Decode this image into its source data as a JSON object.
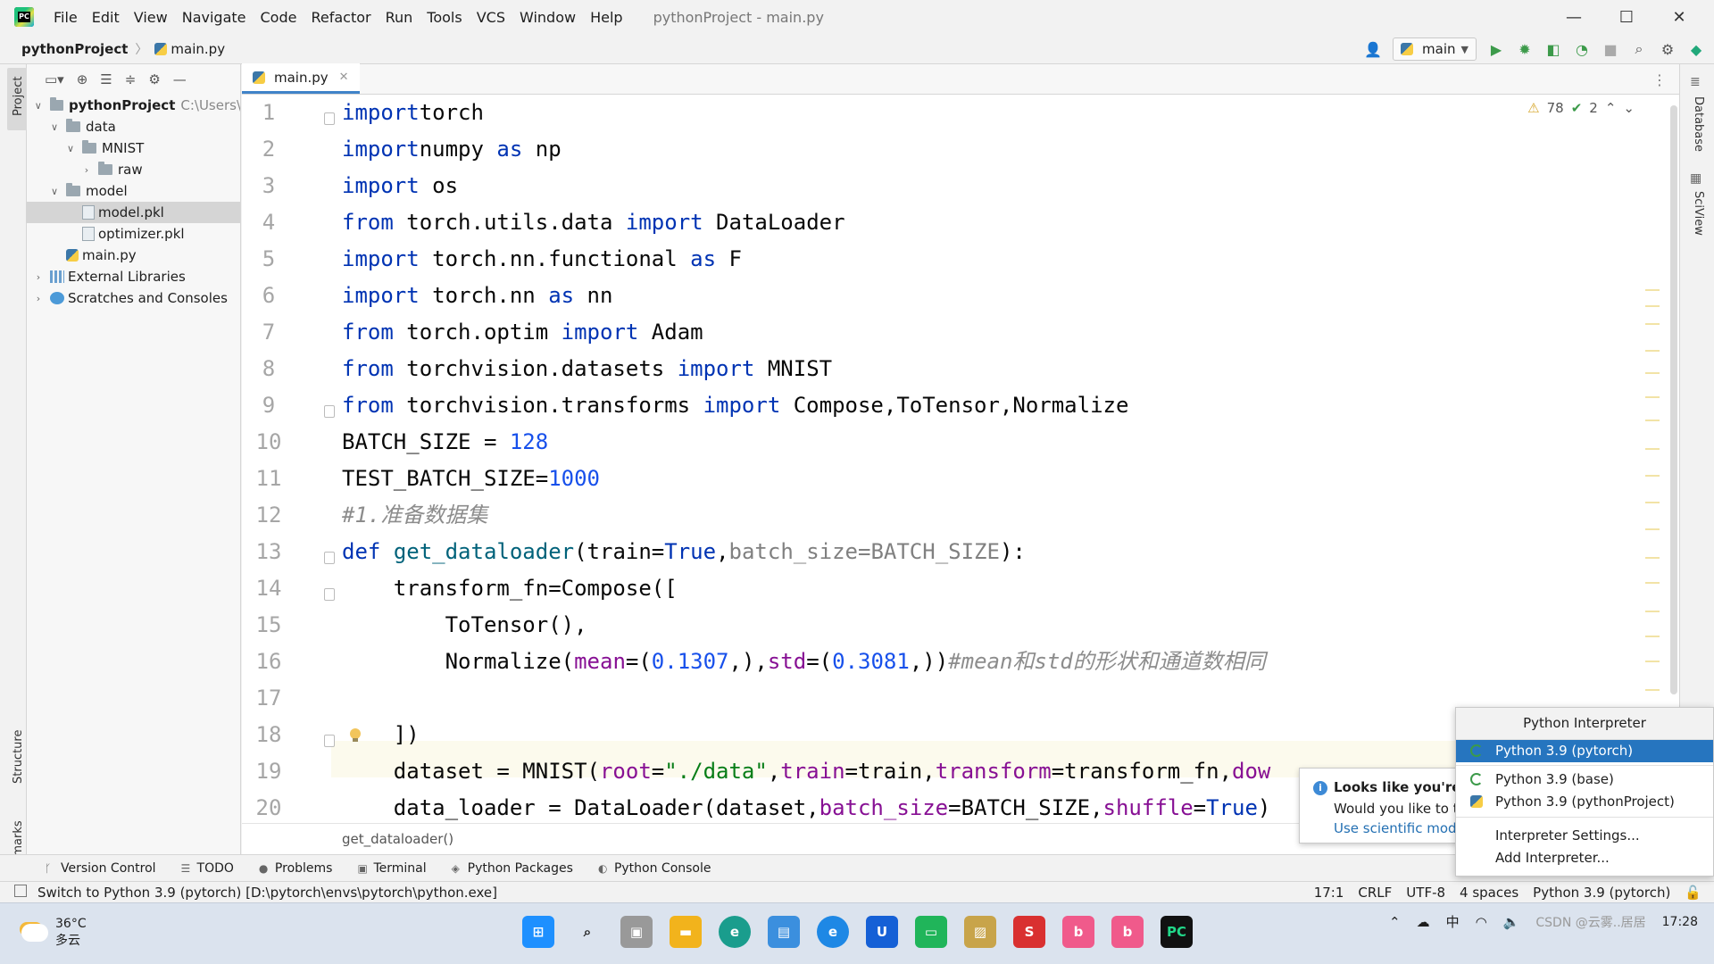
{
  "window": {
    "title": "pythonProject - main.py",
    "menu": [
      "File",
      "Edit",
      "View",
      "Navigate",
      "Code",
      "Refactor",
      "Run",
      "Tools",
      "VCS",
      "Window",
      "Help"
    ],
    "minimize": "—",
    "maximize": "☐",
    "close": "✕"
  },
  "navbar": {
    "project": "pythonProject",
    "file": "main.py",
    "run_config": "main"
  },
  "stripes": {
    "left_top": "Project",
    "left_structure": "Structure",
    "left_bookmarks": "Bookmarks",
    "right_database": "Database",
    "right_sciview": "SciView"
  },
  "project_tree": [
    {
      "label": "pythonProject",
      "extra": "C:\\Users\\",
      "level": 0,
      "type": "folder",
      "open": true
    },
    {
      "label": "data",
      "level": 1,
      "type": "folder",
      "open": true
    },
    {
      "label": "MNIST",
      "level": 2,
      "type": "folder",
      "open": true
    },
    {
      "label": "raw",
      "level": 3,
      "type": "folder",
      "open": false
    },
    {
      "label": "model",
      "level": 1,
      "type": "folder",
      "open": true
    },
    {
      "label": "model.pkl",
      "level": 2,
      "type": "file",
      "selected": true
    },
    {
      "label": "optimizer.pkl",
      "level": 2,
      "type": "file"
    },
    {
      "label": "main.py",
      "level": 1,
      "type": "py"
    },
    {
      "label": "External Libraries",
      "level": 0,
      "type": "lib",
      "open": false
    },
    {
      "label": "Scratches and Consoles",
      "level": 0,
      "type": "scratch",
      "open": false
    }
  ],
  "editor": {
    "tab": "main.py",
    "warnings": "78",
    "checks": "2",
    "breadcrumb": "get_dataloader()",
    "line_numbers": [
      "1",
      "2",
      "3",
      "4",
      "5",
      "6",
      "7",
      "8",
      "9",
      "10",
      "11",
      "12",
      "13",
      "14",
      "15",
      "16",
      "17",
      "18",
      "19",
      "20"
    ],
    "lines": [
      [
        [
          "kw",
          "import"
        ],
        [
          "",
          "torch"
        ]
      ],
      [
        [
          "kw",
          "import"
        ],
        [
          "",
          "numpy "
        ],
        [
          "kw",
          "as"
        ],
        [
          "",
          " np"
        ]
      ],
      [
        [
          "kw",
          "import"
        ],
        [
          "",
          " os"
        ]
      ],
      [
        [
          "kw",
          "from"
        ],
        [
          "",
          " torch.utils.data "
        ],
        [
          "kw",
          "import"
        ],
        [
          "",
          " DataLoader"
        ]
      ],
      [
        [
          "kw",
          "import"
        ],
        [
          "",
          " torch.nn.functional "
        ],
        [
          "kw",
          "as"
        ],
        [
          "",
          " F"
        ]
      ],
      [
        [
          "kw",
          "import"
        ],
        [
          "",
          " torch.nn "
        ],
        [
          "kw",
          "as"
        ],
        [
          "",
          " nn"
        ]
      ],
      [
        [
          "kw",
          "from"
        ],
        [
          "",
          " torch.optim "
        ],
        [
          "kw",
          "import"
        ],
        [
          "",
          " Adam"
        ]
      ],
      [
        [
          "kw",
          "from"
        ],
        [
          "",
          " torchvision.datasets "
        ],
        [
          "kw",
          "import"
        ],
        [
          "",
          " MNIST"
        ]
      ],
      [
        [
          "kw",
          "from"
        ],
        [
          "",
          " torchvision.transforms "
        ],
        [
          "kw",
          "import"
        ],
        [
          "",
          " Compose,ToTensor,Normalize"
        ]
      ],
      [
        [
          "",
          "BATCH_SIZE = "
        ],
        [
          "num",
          "128"
        ]
      ],
      [
        [
          "",
          "TEST_BATCH_SIZE="
        ],
        [
          "num",
          "1000"
        ]
      ],
      [
        [
          "cmt",
          "#1.准备数据集"
        ]
      ],
      [
        [
          "kw",
          "def"
        ],
        [
          "",
          " "
        ],
        [
          "fn",
          "get_dataloader"
        ],
        [
          "",
          "(train="
        ],
        [
          "kw",
          "True"
        ],
        [
          "",
          ","
        ],
        [
          "dimparam",
          "batch_size=BATCH_SIZE"
        ],
        [
          "",
          "):"
        ]
      ],
      [
        [
          "",
          "    transform_fn=Compose(["
        ]
      ],
      [
        [
          "",
          "        ToTensor(),"
        ]
      ],
      [
        [
          "",
          "        Normalize("
        ],
        [
          "param",
          "mean"
        ],
        [
          "",
          "=("
        ],
        [
          "num",
          "0.1307"
        ],
        [
          "",
          ",),"
        ],
        [
          "param",
          "std"
        ],
        [
          "",
          "=("
        ],
        [
          "num",
          "0.3081"
        ],
        [
          "",
          ",))"
        ],
        [
          "cmt",
          "#mean和std的形状和通道数相同"
        ]
      ],
      [
        [
          "",
          ""
        ]
      ],
      [
        [
          "",
          "    ])"
        ]
      ],
      [
        [
          "",
          "    dataset = MNIST("
        ],
        [
          "param",
          "root"
        ],
        [
          "",
          "="
        ],
        [
          "str",
          "\"./data\""
        ],
        [
          "",
          ","
        ],
        [
          "param",
          "train"
        ],
        [
          "",
          "=train,"
        ],
        [
          "param",
          "transform"
        ],
        [
          "",
          "=transform_fn,"
        ],
        [
          "param",
          "dow"
        ]
      ],
      [
        [
          "",
          "    data_loader = DataLoader(dataset,"
        ],
        [
          "param",
          "batch_size"
        ],
        [
          "",
          "=BATCH_SIZE,"
        ],
        [
          "param",
          "shuffle"
        ],
        [
          "",
          "="
        ],
        [
          "kw",
          "True"
        ],
        [
          "",
          ")"
        ]
      ]
    ]
  },
  "toolwindows": [
    "Version Control",
    "TODO",
    "Problems",
    "Terminal",
    "Python Packages",
    "Python Console"
  ],
  "status": {
    "message": "Switch to Python 3.9 (pytorch) [D:\\pytorch\\envs\\pytorch\\python.exe]",
    "position": "17:1",
    "line_sep": "CRLF",
    "encoding": "UTF-8",
    "indent": "4 spaces",
    "interpreter": "Python 3.9 (pytorch)"
  },
  "notification": {
    "title": "Looks like you're u",
    "body": "Would you like to t",
    "link": "Use scientific mode"
  },
  "interpreter_popup": {
    "header": "Python Interpreter",
    "items": [
      "Python 3.9 (pytorch)",
      "Python 3.9 (base)",
      "Python 3.9 (pythonProject)"
    ],
    "actions": [
      "Interpreter Settings...",
      "Add Interpreter..."
    ]
  },
  "taskbar": {
    "temp": "36°C",
    "weather": "多云",
    "time": "17:28",
    "ime": "中",
    "watermark": "CSDN @云雾..居居"
  }
}
